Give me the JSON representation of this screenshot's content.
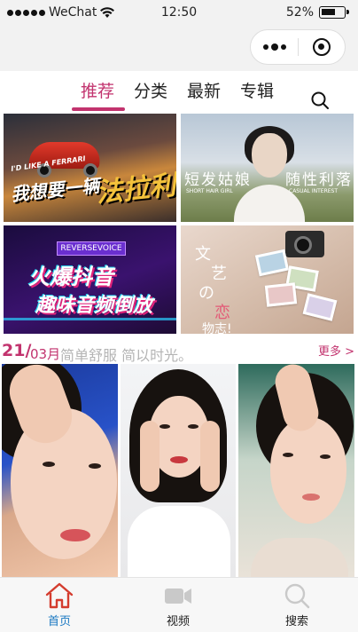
{
  "status_bar": {
    "carrier": "WeChat",
    "time": "12:50",
    "battery": "52%"
  },
  "nav": {
    "tabs": [
      "推荐",
      "分类",
      "最新",
      "专辑"
    ],
    "active_tab": "推荐"
  },
  "banners": {
    "banner1": {
      "small_text": "I'D LIKE A FERRARI",
      "text_a": "我想要一辆",
      "text_b": "法拉利"
    },
    "banner2": {
      "text_a": "短发姑娘",
      "text_b": "随性利落",
      "sub_a": "SHORT HAIR GIRL",
      "sub_b": "CASUAL INTEREST"
    },
    "banner3": {
      "tag": "REVERSEVOICE",
      "line1": "火爆抖音",
      "line2": "趣味音频倒放"
    },
    "banner4": {
      "w1": "文",
      "w2": "艺",
      "w3": "の",
      "w4": "恋",
      "w5": "物志!"
    }
  },
  "section": {
    "day": "21/",
    "month": "03月",
    "title": "简单舒服 简以时光。",
    "more": "更多 >"
  },
  "tabbar": {
    "items": [
      {
        "label": "首页",
        "icon": "home-icon"
      },
      {
        "label": "视频",
        "icon": "video-camera-icon"
      },
      {
        "label": "搜索",
        "icon": "search-icon"
      }
    ],
    "active_index": 0
  },
  "colors": {
    "accent": "#c2336e",
    "tab_active_blue": "#1a78c2",
    "section_title_gray": "#b4b4b4"
  }
}
